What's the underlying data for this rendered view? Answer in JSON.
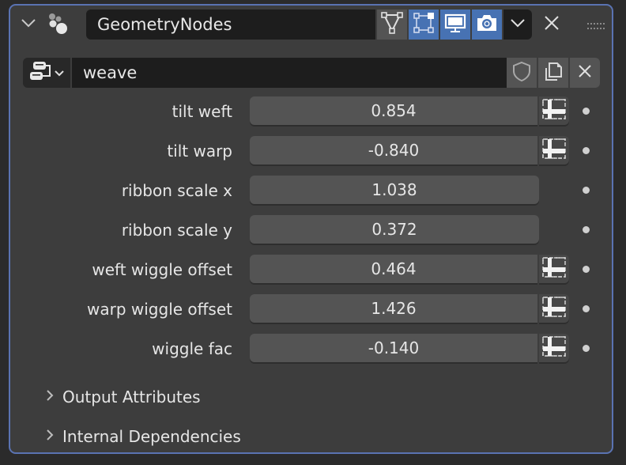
{
  "modifier": {
    "name": "GeometryNodes",
    "toggles": [
      {
        "name": "edit-mode-toggle",
        "icon": "edit-mode-triangle-icon",
        "active": false
      },
      {
        "name": "on-cage-toggle",
        "icon": "vertex-cage-icon",
        "active": true
      },
      {
        "name": "viewport-toggle",
        "icon": "monitor-icon",
        "active": true
      },
      {
        "name": "render-toggle",
        "icon": "camera-icon",
        "active": true
      }
    ],
    "dropdown_icon": "chevron-down-icon",
    "remove_icon": "close-icon",
    "drag_icon": "drag-handle-icon"
  },
  "node_group": {
    "name": "weave",
    "selector_icon": "node-tree-icon",
    "fake_user_icon": "shield-icon",
    "duplicate_icon": "duplicate-icon",
    "unlink_icon": "close-icon"
  },
  "inputs": [
    {
      "label": "tilt weft",
      "value": "0.854",
      "has_attribute_toggle": true
    },
    {
      "label": "tilt warp",
      "value": "-0.840",
      "has_attribute_toggle": true
    },
    {
      "label": "ribbon scale x",
      "value": "1.038",
      "has_attribute_toggle": false
    },
    {
      "label": "ribbon scale y",
      "value": "0.372",
      "has_attribute_toggle": false
    },
    {
      "label": "weft wiggle offset",
      "value": "0.464",
      "has_attribute_toggle": true
    },
    {
      "label": "warp wiggle offset",
      "value": "1.426",
      "has_attribute_toggle": true
    },
    {
      "label": "wiggle fac",
      "value": "-0.140",
      "has_attribute_toggle": true
    }
  ],
  "subpanels": [
    {
      "label": "Output Attributes",
      "expanded": false
    },
    {
      "label": "Internal Dependencies",
      "expanded": false
    }
  ],
  "colors": {
    "accent": "#4772b3",
    "panel_border": "#5a73b2",
    "panel_bg": "#3d3d3d",
    "field_bg": "#545454"
  }
}
